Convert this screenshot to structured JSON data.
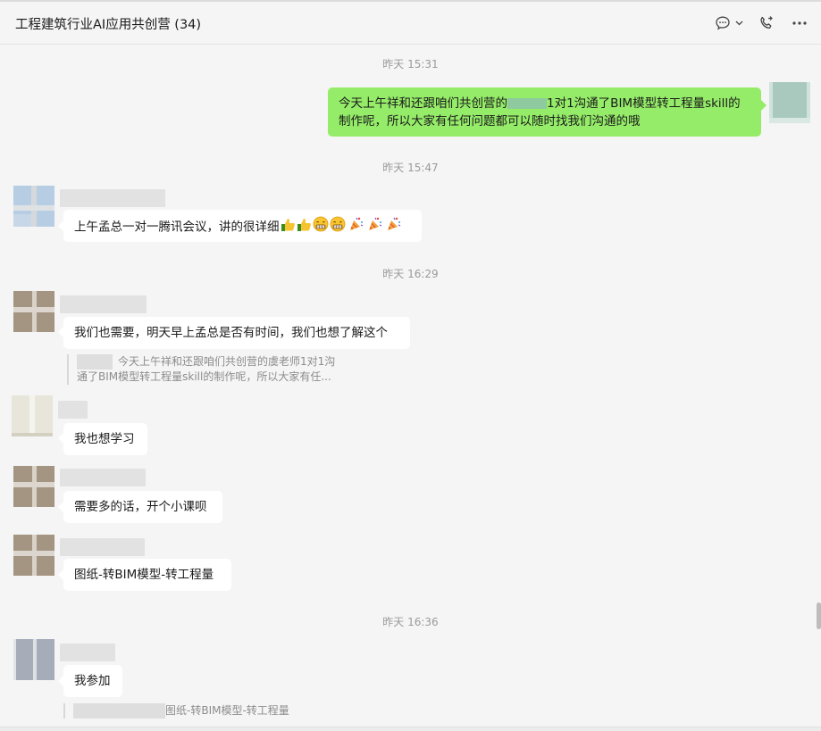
{
  "header": {
    "title": "工程建筑行业AI应用共创营 (34)",
    "icons": [
      "chat-bubble-icon",
      "chevron-down-icon",
      "phone-icon",
      "more-icon"
    ]
  },
  "messages": [
    {
      "type": "time",
      "text": "昨天 15:31"
    },
    {
      "type": "out",
      "line1_a": "今天上午祥和还跟咱们共创营的",
      "line1_b": "1对1沟通了BIM模型转工程量skill的",
      "line2": "制作呢，所以大家有任何问题都可以随时找我们沟通的哦"
    },
    {
      "type": "time",
      "text": "昨天 15:47"
    },
    {
      "type": "in",
      "text": "上午孟总一对一腾讯会议，讲的很详细",
      "emojis": [
        "thumbs-up",
        "thumbs-up",
        "grin",
        "grin",
        "party-popper",
        "party-popper",
        "party-popper"
      ]
    },
    {
      "type": "time",
      "text": "昨天 16:29"
    },
    {
      "type": "in",
      "text": "我们也需要，明天早上孟总是否有时间，我们也想了解这个",
      "quote_line1": "今天上午祥和还跟咱们共创营的虞老师1对1沟",
      "quote_line2": "通了BIM模型转工程量skill的制作呢，所以大家有任..."
    },
    {
      "type": "in",
      "text": "我也想学习"
    },
    {
      "type": "in",
      "text": "需要多的话，开个小课呗"
    },
    {
      "type": "in",
      "text": "图纸-转BIM模型-转工程量"
    },
    {
      "type": "time",
      "text": "昨天 16:36"
    },
    {
      "type": "in",
      "text": "我参加",
      "quote_line1": "图纸-转BIM模型-转工程量"
    }
  ],
  "colors": {
    "outgoing_bubble": "#95ec69",
    "incoming_bubble": "#ffffff",
    "background": "#f5f5f5"
  }
}
